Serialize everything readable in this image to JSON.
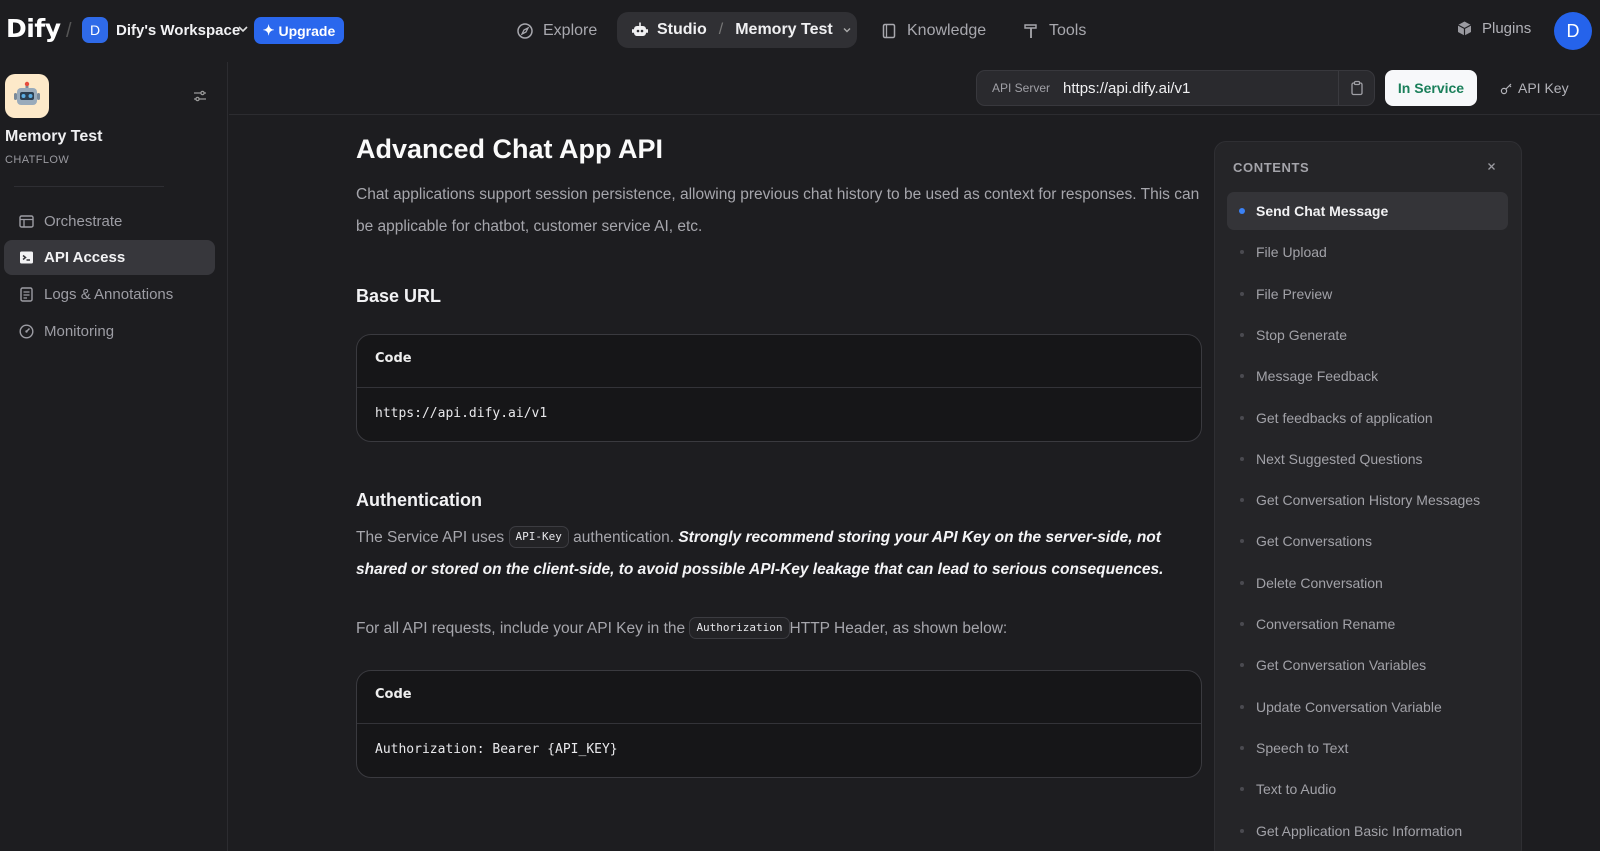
{
  "topbar": {
    "logo": "Dify",
    "workspace_initial": "D",
    "workspace_name": "Dify's Workspace",
    "upgrade_label": "Upgrade",
    "nav": {
      "explore": "Explore",
      "studio": "Studio",
      "app": "Memory Test",
      "knowledge": "Knowledge",
      "tools": "Tools"
    },
    "plugins_label": "Plugins",
    "user_initial": "D"
  },
  "sidebar": {
    "app_name": "Memory Test",
    "app_type": "CHATFLOW",
    "items": [
      {
        "label": "Orchestrate",
        "icon": "layout-icon",
        "active": false
      },
      {
        "label": "API Access",
        "icon": "terminal-icon",
        "active": true
      },
      {
        "label": "Logs & Annotations",
        "icon": "log-icon",
        "active": false
      },
      {
        "label": "Monitoring",
        "icon": "gauge-icon",
        "active": false
      }
    ]
  },
  "header": {
    "api_server_label": "API Server",
    "api_server_url": "https://api.dify.ai/v1",
    "status_label": "In Service",
    "api_key_label": "API Key"
  },
  "doc": {
    "title": "Advanced Chat App API",
    "description": "Chat applications support session persistence, allowing previous chat history to be used as context for responses. This can be applicable for chatbot, customer service AI, etc.",
    "base_url_heading": "Base URL",
    "code1_label": "Code",
    "code1_body": "https://api.dify.ai/v1",
    "auth_heading": "Authentication",
    "auth_p1_prefix": "The Service API uses",
    "auth_p1_code": "API-Key",
    "auth_p1_mid": "authentication.",
    "auth_p1_bold": "Strongly recommend storing your API Key on the server-side, not shared or stored on the client-side, to avoid possible API-Key leakage that can lead to serious consequences.",
    "auth_p2_prefix": "For all API requests, include your API Key in the",
    "auth_p2_code": "Authorization",
    "auth_p2_suffix": "HTTP Header, as shown below:",
    "code2_label": "Code",
    "code2_body": "Authorization: Bearer {API_KEY}"
  },
  "toc": {
    "title": "CONTENTS",
    "items": [
      {
        "label": "Send Chat Message",
        "active": true
      },
      {
        "label": "File Upload"
      },
      {
        "label": "File Preview"
      },
      {
        "label": "Stop Generate"
      },
      {
        "label": "Message Feedback"
      },
      {
        "label": "Get feedbacks of application"
      },
      {
        "label": "Next Suggested Questions"
      },
      {
        "label": "Get Conversation History Messages"
      },
      {
        "label": "Get Conversations"
      },
      {
        "label": "Delete Conversation"
      },
      {
        "label": "Conversation Rename"
      },
      {
        "label": "Get Conversation Variables"
      },
      {
        "label": "Update Conversation Variable"
      },
      {
        "label": "Speech to Text"
      },
      {
        "label": "Text to Audio"
      },
      {
        "label": "Get Application Basic Information"
      }
    ]
  },
  "colors": {
    "accent": "#2a67ed",
    "status": "#1a7f5a",
    "background": "#1d1d20"
  }
}
